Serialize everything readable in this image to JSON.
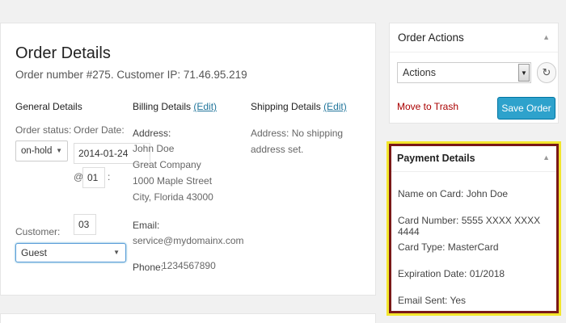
{
  "order": {
    "title": "Order Details",
    "subtitle": "Order number #275. Customer IP: 71.46.95.219"
  },
  "general": {
    "heading": "General Details",
    "status_label": "Order status:",
    "status_value": "on-hold",
    "date_label": "Order Date:",
    "date_value": "2014-01-24",
    "hour_separator": "@",
    "hour_value": "01",
    "minute_separator": ":",
    "minute_value": "03",
    "customer_label": "Customer:",
    "customer_value": "Guest"
  },
  "billing": {
    "heading": "Billing Details",
    "edit_label": "(Edit)",
    "address_label": "Address:",
    "address_lines": [
      "John Doe",
      "Great Company",
      "1000 Maple Street",
      "City, Florida 43000"
    ],
    "email_label": "Email:",
    "email_value": "service@mydomainx.com",
    "phone_label": "Phone:",
    "phone_value": "1234567890"
  },
  "shipping": {
    "heading": "Shipping Details",
    "edit_label": "(Edit)",
    "address_label": "Address:",
    "address_text_1": "No shipping",
    "address_text_2": "address set."
  },
  "actions": {
    "heading": "Order Actions",
    "select_value": "Actions",
    "trash_label": "Move to Trash",
    "save_label": "Save Order"
  },
  "payment": {
    "heading": "Payment Details",
    "lines": [
      "Name on Card: John Doe",
      "Card Number: 5555 XXXX XXXX 4444",
      "Card Type: MasterCard",
      "Expiration Date: 01/2018",
      "Email Sent: Yes"
    ]
  },
  "icons": {
    "toggle": "▲",
    "select_arrow": "▼",
    "refresh": "↻"
  }
}
